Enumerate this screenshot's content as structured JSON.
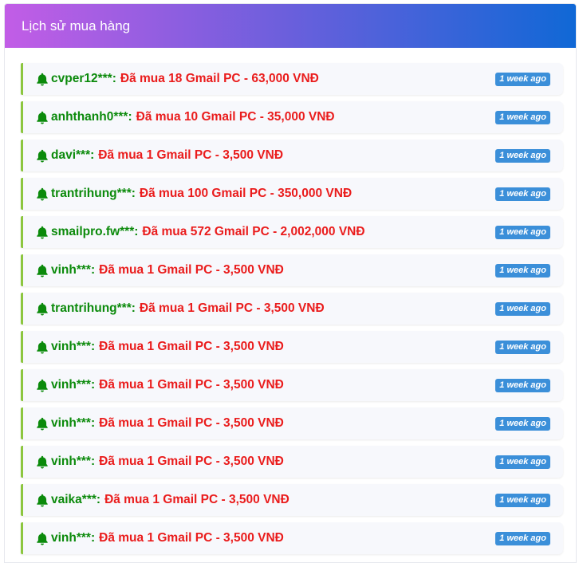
{
  "header": {
    "title": "Lịch sử mua hàng"
  },
  "colors": {
    "header_gradient_start": "#c25de6",
    "header_gradient_end": "#1068d6",
    "username": "#0b8a0b",
    "message": "#ea1c1c",
    "badge": "#3b8fd9",
    "row_accent": "#8cc63f"
  },
  "icons": {
    "row_icon": "bell-icon"
  },
  "purchases": [
    {
      "user": "cvper12***",
      "message": "Đã mua 18 Gmail PC - 63,000 VNĐ",
      "time": "1 week ago"
    },
    {
      "user": "anhthanh0***",
      "message": "Đã mua 10 Gmail PC - 35,000 VNĐ",
      "time": "1 week ago"
    },
    {
      "user": "davi***",
      "message": "Đã mua 1 Gmail PC - 3,500 VNĐ",
      "time": "1 week ago"
    },
    {
      "user": "trantrihung***",
      "message": "Đã mua 100 Gmail PC - 350,000 VNĐ",
      "time": "1 week ago"
    },
    {
      "user": "smailpro.fw***",
      "message": "Đã mua 572 Gmail PC - 2,002,000 VNĐ",
      "time": "1 week ago"
    },
    {
      "user": "vinh***",
      "message": "Đã mua 1 Gmail PC - 3,500 VNĐ",
      "time": "1 week ago"
    },
    {
      "user": "trantrihung***",
      "message": "Đã mua 1 Gmail PC - 3,500 VNĐ",
      "time": "1 week ago"
    },
    {
      "user": "vinh***",
      "message": "Đã mua 1 Gmail PC - 3,500 VNĐ",
      "time": "1 week ago"
    },
    {
      "user": "vinh***",
      "message": "Đã mua 1 Gmail PC - 3,500 VNĐ",
      "time": "1 week ago"
    },
    {
      "user": "vinh***",
      "message": "Đã mua 1 Gmail PC - 3,500 VNĐ",
      "time": "1 week ago"
    },
    {
      "user": "vinh***",
      "message": "Đã mua 1 Gmail PC - 3,500 VNĐ",
      "time": "1 week ago"
    },
    {
      "user": "vaika***",
      "message": "Đã mua 1 Gmail PC - 3,500 VNĐ",
      "time": "1 week ago"
    },
    {
      "user": "vinh***",
      "message": "Đã mua 1 Gmail PC - 3,500 VNĐ",
      "time": "1 week ago"
    }
  ]
}
